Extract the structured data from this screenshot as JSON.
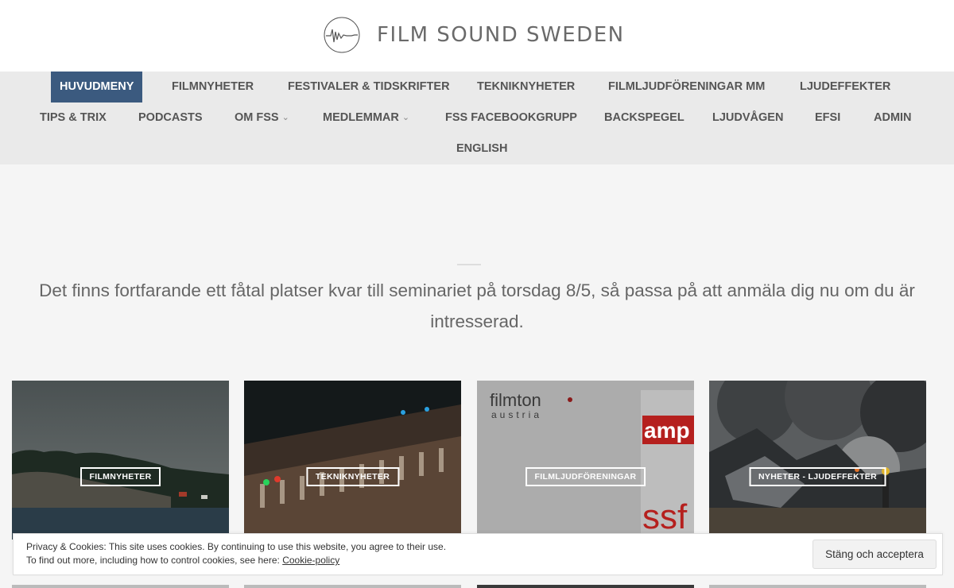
{
  "site": {
    "name": "FILM SOUND SWEDEN"
  },
  "nav": {
    "items": [
      {
        "label": "HUVUDMENY",
        "active": true
      },
      {
        "label": "FILMNYHETER"
      },
      {
        "label": "FESTIVALER & TIDSKRIFTER"
      },
      {
        "label": "TEKNIKNYHETER"
      },
      {
        "label": "FILMLJUDFÖRENINGAR MM"
      },
      {
        "label": "LJUDEFFEKTER"
      },
      {
        "label": "TIPS & TRIX"
      },
      {
        "label": "PODCASTS"
      },
      {
        "label": "OM FSS",
        "dropdown": true
      },
      {
        "label": "MEDLEMMAR",
        "dropdown": true
      },
      {
        "label": "FSS FACEBOOKGRUPP"
      },
      {
        "label": "BACKSPEGEL"
      },
      {
        "label": "LJUDVÅGEN"
      },
      {
        "label": "EFSI"
      },
      {
        "label": "ADMIN"
      },
      {
        "label": "ENGLISH"
      }
    ],
    "active_color": "#3b5a7f",
    "chevron_icon": "chevron-down-icon"
  },
  "intro": {
    "text": "Det finns fortfarande ett fåtal platser kvar till seminariet på torsdag 8/5, så passa på att anmäla dig nu om du är intresserad."
  },
  "cards": [
    {
      "category": "FILMNYHETER",
      "image": "coastline-photo"
    },
    {
      "category": "TEKNIKNYHETER",
      "image": "mixing-console-photo"
    },
    {
      "category": "FILMLJUDFÖRENINGAR",
      "image": "sound-associations-logos",
      "logo_text": {
        "filmton": "filmton",
        "austria": "austria",
        "amp": "amp",
        "ssf": "ssf"
      }
    },
    {
      "category": "NYHETER - LJUDEFFEKTER",
      "image": "plane-wreck-smoke-photo"
    }
  ],
  "cookie": {
    "line1": "Privacy & Cookies: This site uses cookies. By continuing to use this website, you agree to their use.",
    "line2_prefix": "To find out more, including how to control cookies, see here: ",
    "link_label": "Cookie-policy",
    "accept_label": "Stäng och acceptera"
  }
}
